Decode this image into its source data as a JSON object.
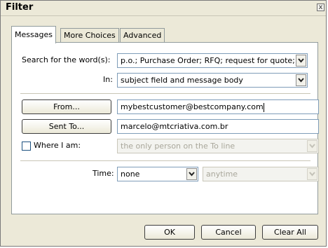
{
  "window": {
    "title": "Filter",
    "close_glyph": "x"
  },
  "tabs": [
    {
      "label": "Messages",
      "active": true
    },
    {
      "label": "More Choices",
      "active": false
    },
    {
      "label": "Advanced",
      "active": false
    }
  ],
  "messages_tab": {
    "search_label": "Search for the word(s):",
    "search_value": "p.o.; Purchase Order; RFQ; request for quote;",
    "in_label": "In:",
    "in_value": "subject field and message body",
    "from_button": "From...",
    "from_value": "mybestcustomer@bestcompany.com",
    "sent_to_button": "Sent To...",
    "sent_to_value": "marcelo@mtcriativa.com.br",
    "where_label": "Where I am:",
    "where_checked": false,
    "where_value": "the only person on the To line",
    "time_label": "Time:",
    "time_value": "none",
    "time_range_value": "anytime"
  },
  "buttons": {
    "ok": "OK",
    "cancel": "Cancel",
    "clear_all": "Clear All"
  },
  "icons": {
    "dropdown": "chevron-down-icon",
    "close": "close-icon"
  }
}
